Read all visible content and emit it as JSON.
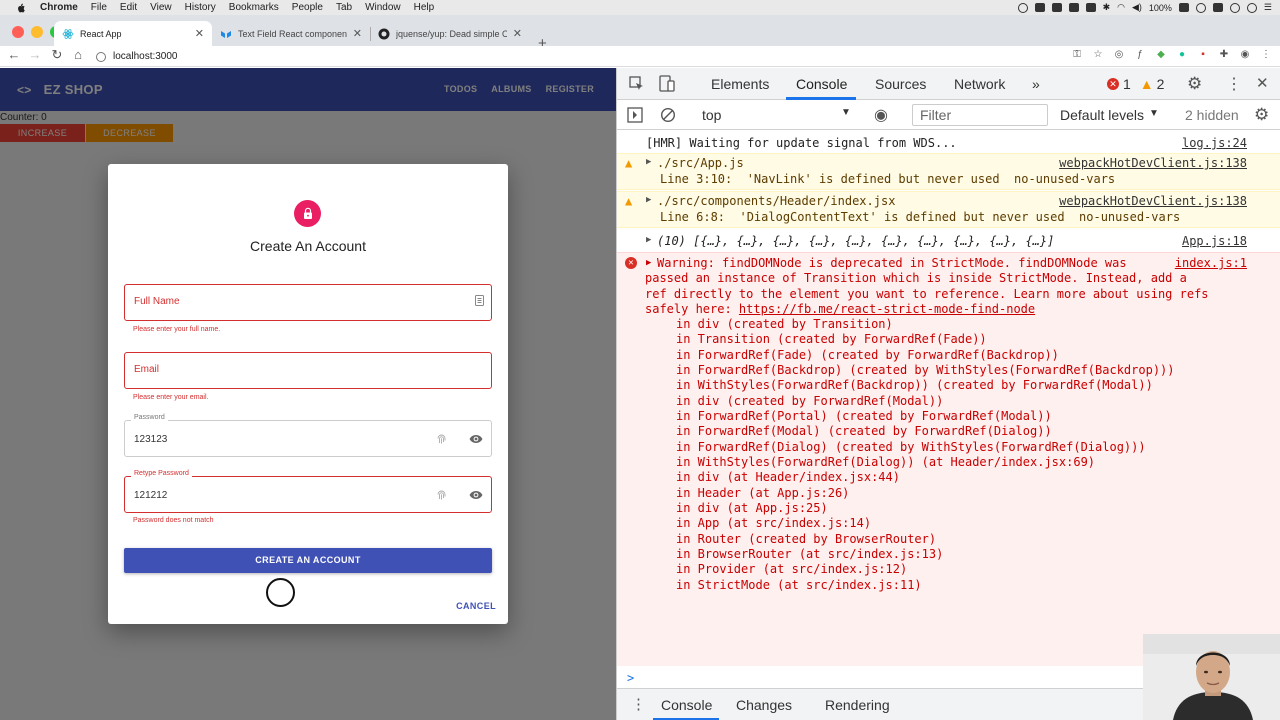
{
  "menubar": {
    "app": "Chrome",
    "items": [
      "File",
      "Edit",
      "View",
      "History",
      "Bookmarks",
      "People",
      "Tab",
      "Window",
      "Help"
    ],
    "battery": "100%"
  },
  "tabs": [
    {
      "title": "React App",
      "active": true
    },
    {
      "title": "Text Field React component - M",
      "active": false
    },
    {
      "title": "jquense/yup: Dead simple Obje",
      "active": false
    }
  ],
  "address": {
    "url": "localhost:3000"
  },
  "app": {
    "brand": "EZ SHOP",
    "nav": [
      "TODOS",
      "ALBUMS",
      "REGISTER"
    ],
    "counter": "Counter: 0",
    "increase": "INCREASE",
    "decrease": "DECREASE"
  },
  "dialog": {
    "title": "Create An Account",
    "full_name_placeholder": "Full Name",
    "full_name_helper": "Please enter your full name.",
    "email_placeholder": "Email",
    "email_helper": "Please enter your email.",
    "password_label": "Password",
    "password_value": "123123",
    "retype_label": "Retype Password",
    "retype_value": "121212",
    "retype_helper": "Password does not match",
    "submit": "CREATE AN ACCOUNT",
    "cancel": "CANCEL"
  },
  "devtools": {
    "tabs": [
      "Elements",
      "Console",
      "Sources",
      "Network"
    ],
    "error_count": "1",
    "warn_count": "2",
    "context": "top",
    "filter_placeholder": "Filter",
    "levels": "Default levels",
    "hidden": "2 hidden",
    "logs": {
      "hmr": "[HMR] Waiting for update signal from WDS...",
      "hmr_src": "log.js:24",
      "w1_file": "./src/App.js",
      "w1_msg": "Line 3:10:  'NavLink' is defined but never used  no-unused-vars",
      "w1_src": "webpackHotDevClient.js:138",
      "w2_file": "./src/components/Header/index.jsx",
      "w2_msg": "Line 6:8:  'DialogContentText' is defined but never used  no-unused-vars",
      "w2_src": "webpackHotDevClient.js:138",
      "arr": "(10) [{…}, {…}, {…}, {…}, {…}, {…}, {…}, {…}, {…}, {…}]",
      "arr_src": "App.js:18",
      "err_src": "index.js:1",
      "err_l1": "Warning: findDOMNode is deprecated in StrictMode. findDOMNode was",
      "err_l2": "passed an instance of Transition which is inside StrictMode. Instead, add a",
      "err_l3": "ref directly to the element you want to reference. Learn more about using refs",
      "err_l4_pre": "safely here: ",
      "err_l4_link": "https://fb.me/react-strict-mode-find-node",
      "stack": [
        "in div (created by Transition)",
        "in Transition (created by ForwardRef(Fade))",
        "in ForwardRef(Fade) (created by ForwardRef(Backdrop))",
        "in ForwardRef(Backdrop) (created by WithStyles(ForwardRef(Backdrop)))",
        "in WithStyles(ForwardRef(Backdrop)) (created by ForwardRef(Modal))",
        "in div (created by ForwardRef(Modal))",
        "in ForwardRef(Portal) (created by ForwardRef(Modal))",
        "in ForwardRef(Modal) (created by ForwardRef(Dialog))",
        "in ForwardRef(Dialog) (created by WithStyles(ForwardRef(Dialog)))",
        "in WithStyles(ForwardRef(Dialog)) (at Header/index.jsx:69)",
        "in div (at Header/index.jsx:44)",
        "in Header (at App.js:26)",
        "in div (at App.js:25)",
        "in App (at src/index.js:14)",
        "in Router (created by BrowserRouter)",
        "in BrowserRouter (at src/index.js:13)",
        "in Provider (at src/index.js:12)",
        "in StrictMode (at src/index.js:11)"
      ]
    },
    "drawer_tabs": [
      "Console",
      "Changes",
      "Rendering"
    ]
  }
}
